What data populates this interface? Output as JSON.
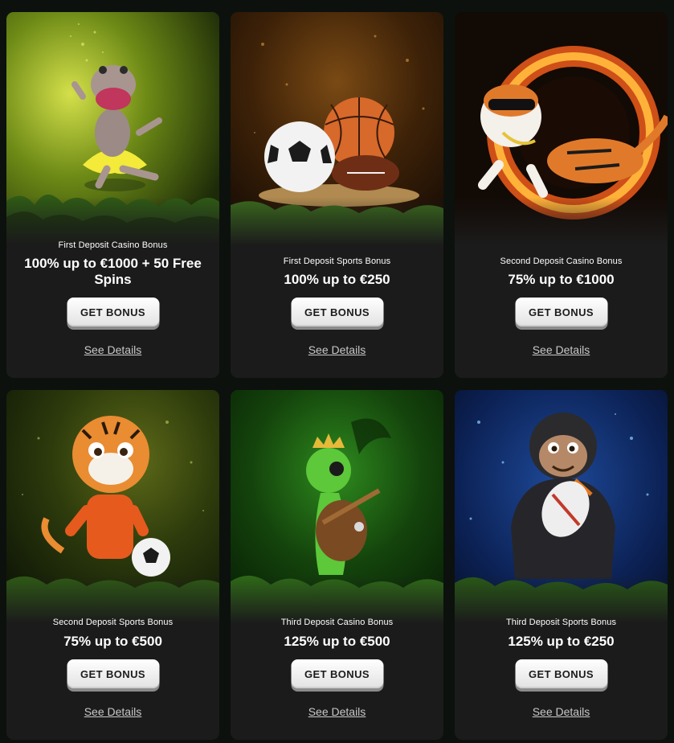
{
  "cards": [
    {
      "subtitle": "First Deposit Casino Bonus",
      "offer": "100% up to €1000 + 50 Free Spins",
      "button": "GET BONUS",
      "link": "See Details",
      "art": "hippo-ballerina"
    },
    {
      "subtitle": "First Deposit Sports Bonus",
      "offer": "100% up to €250",
      "button": "GET BONUS",
      "link": "See Details",
      "art": "sports-balls"
    },
    {
      "subtitle": "Second Deposit Casino Bonus",
      "offer": "75% up to €1000",
      "button": "GET BONUS",
      "link": "See Details",
      "art": "tiger-fire-ring"
    },
    {
      "subtitle": "Second Deposit Sports Bonus",
      "offer": "75% up to €500",
      "button": "GET BONUS",
      "link": "See Details",
      "art": "tiger-cub-football"
    },
    {
      "subtitle": "Third Deposit Casino Bonus",
      "offer": "125% up to €500",
      "button": "GET BONUS",
      "link": "See Details",
      "art": "turtle-king-guitar"
    },
    {
      "subtitle": "Third Deposit Sports Bonus",
      "offer": "125% up to €250",
      "button": "GET BONUS",
      "link": "See Details",
      "art": "gorilla-rugby"
    }
  ],
  "colors": {
    "page_background": "#0c110d",
    "card_background": "#1b1b1b",
    "button_background": "#f2f2f2",
    "button_text": "#1b1b1b",
    "link_text": "#c8c8c8"
  }
}
